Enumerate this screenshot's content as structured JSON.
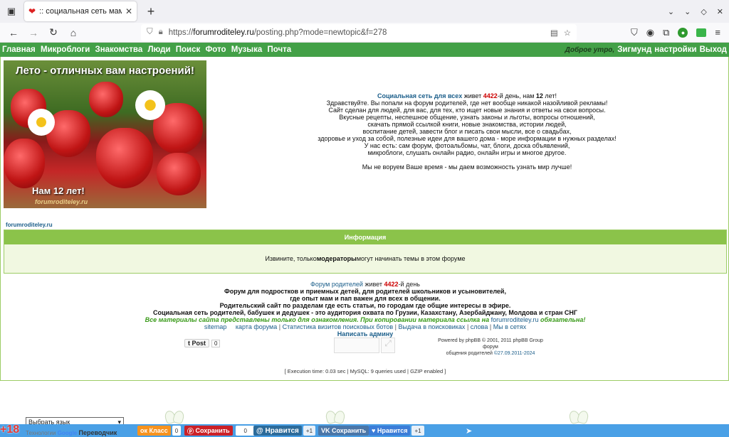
{
  "browser": {
    "tab_title": ":: социальная сеть мам и п",
    "url_prefix": "https://",
    "url_host": "forumroditeley.ru",
    "url_path": "/posting.php?mode=newtopic&f=278"
  },
  "site_menu": {
    "left": [
      "Главная",
      "Микроблоги",
      "Знакомства",
      "Люди",
      "Поиск",
      "Фото",
      "Музыка",
      "Почта"
    ],
    "greeting": "Доброе утро,",
    "user": "Зигмунд",
    "settings": "настройки",
    "logout": "Выход"
  },
  "banner": {
    "title": "Лето - отличных вам настроений!",
    "age": "Нам 12 лет!",
    "site": "forumroditeley.ru"
  },
  "intro": {
    "l1_link": "Социальная сеть для всех",
    "l1_a": " живет ",
    "l1_days": "4422",
    "l1_b": "-й день, нам ",
    "l1_years": "12",
    "l1_c": " лет!",
    "lines": [
      "Здравствуйте. Вы попали на форум родителей, где нет вообще никакой назойливой рекламы!",
      "Сайт сделан для людей, для вас, для тех, кто ищет новые знания и ответы на свои вопросы.",
      "Вкусные рецепты, неспешное общение, узнать законы и льготы, вопросы отношений,",
      "скачать прямой ссылкой книги, новые знакомства, истории людей,",
      "воспитание детей, завести блог и писать свои мысли, все о свадьбах,",
      "здоровье и уход за собой, полезные идеи для вашего дома - море информации в нужных разделах!",
      "У нас есть: сам форум, фотоальбомы, чат, блоги, доска объявлений,",
      "микроблоги, слушать онлайн радио, онлайн игры и многое другое."
    ],
    "closing": "Мы не воруем Ваше время - мы даем возможность узнать мир лучше!"
  },
  "site_link": "forumroditeley.ru",
  "info": {
    "header": "Информация",
    "msg_a": "Извините, только ",
    "msg_bold": "модераторы",
    "msg_b": " могут начинать темы в этом форуме"
  },
  "footer": {
    "f1_link": "Форум родителей",
    "f1_a": " живет ",
    "f1_days": "4422",
    "f1_b": "-й день",
    "bold_lines": [
      "Форум для подростков и приемных детей, для родителей школьников и усыновителей,",
      "где опыт мам и пап важен для всех в общении.",
      "Родительский сайт по разделам где есть статьи, по городам где общие интересы в эфире.",
      "Социальная сеть родителей, бабушек и дедушек - это аудитория охвата по Грузии, Казахстану, Азербайджану, Молдова и стран СНГ"
    ],
    "notice_a": "Все материалы сайта представлены только для ознакомления. При копировании материала ссылка на ",
    "notice_link": "forumroditeley.ru",
    "notice_b": " обязательна!",
    "links": [
      "sitemap",
      "карта форума",
      "Статистика визитов поисковых ботов",
      "Выдача в поисковиках",
      "слова",
      "Мы в сетях"
    ],
    "write_admin": "Написать админу",
    "post_btn": "Post",
    "post_count": "0",
    "powered_a": "Powered by phpBB © 2001, 2011 phpBB Group форум",
    "powered_b": "общения родителей",
    "powered_date": "©27.09.2011-2024",
    "exec": "[ Execution time: 0.03 sec | MySQL: 9 queries used | GZIP enabled ]"
  },
  "bottom": {
    "lang_select": "Выбрать язык",
    "translit_a": "Технологии ",
    "translit_g": "Google",
    "translit_b": "Переводчик",
    "plus18": "+18",
    "ok_label": "Класс",
    "ok_count": "0",
    "pin_label": "Сохранить",
    "pin_count": "0",
    "like_label": "Нравится",
    "like_count": "+1",
    "vk_label": "Сохранить",
    "heart_label": "Нравится",
    "heart_count": "+1"
  }
}
